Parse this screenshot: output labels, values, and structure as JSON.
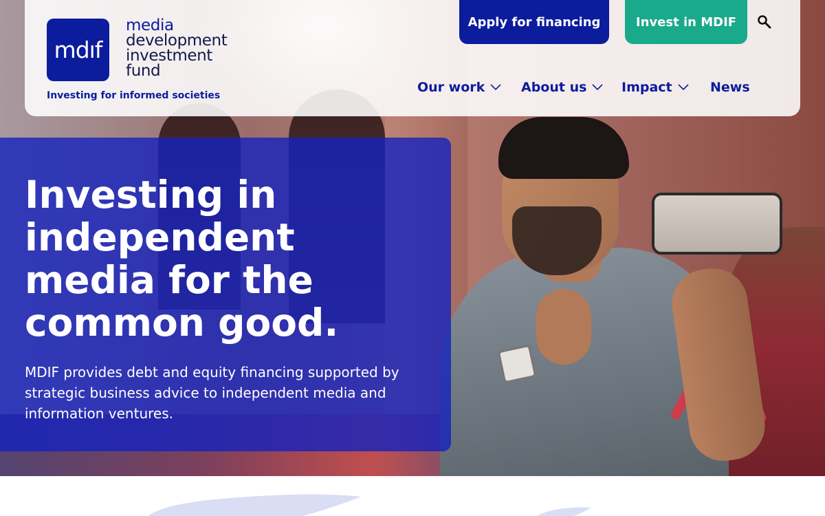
{
  "header": {
    "logo_mark": "mdıf",
    "logo_words": [
      "media",
      "development",
      "investment",
      "fund"
    ],
    "tagline": "Investing for informed societies",
    "apply_label": "Apply for financing",
    "invest_label": "Invest in MDIF",
    "search_icon": "search-icon"
  },
  "nav": {
    "items": [
      {
        "label": "Our work",
        "has_dropdown": true
      },
      {
        "label": "About us",
        "has_dropdown": true
      },
      {
        "label": "Impact",
        "has_dropdown": true
      },
      {
        "label": "News",
        "has_dropdown": false
      }
    ]
  },
  "hero": {
    "title": "Investing in independent media for the common good.",
    "text": "MDIF provides debt and equity financing supported by strategic business advice to independent media and information ventures."
  },
  "colors": {
    "brand_blue": "#0b1c9c",
    "invest_green": "#19a98b",
    "overlay_blue": "#1422be"
  }
}
